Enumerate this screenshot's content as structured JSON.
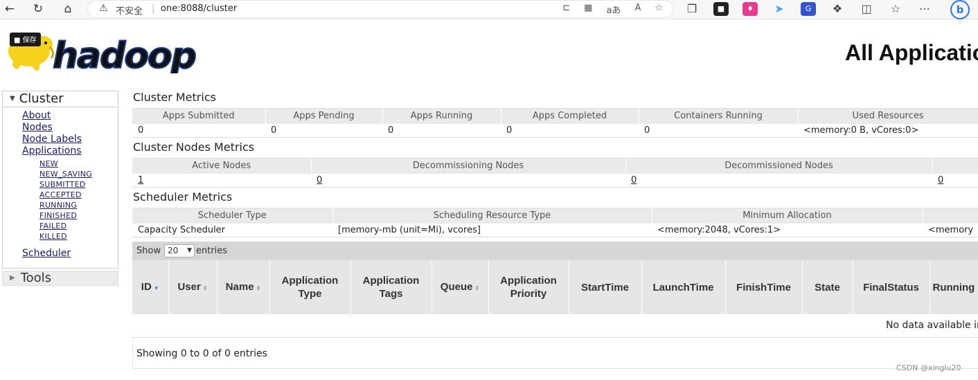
{
  "browser": {
    "warning_text": "不安全",
    "separator": "|",
    "url": "one:8088/cluster",
    "address_icons": [
      "⊏",
      "▦",
      "aあ",
      "A",
      "☆"
    ],
    "ext_colors": [
      "#222222",
      "#e83a8f",
      "#4aa3ff",
      "#3355cc"
    ]
  },
  "header": {
    "save_badge": "保存",
    "logo_text": "hadoop",
    "page_title": "All Applications"
  },
  "sidebar": {
    "cluster_label": "Cluster",
    "links": [
      "About",
      "Nodes",
      "Node Labels",
      "Applications"
    ],
    "app_states": [
      "NEW",
      "NEW_SAVING",
      "SUBMITTED",
      "ACCEPTED",
      "RUNNING",
      "FINISHED",
      "FAILED",
      "KILLED"
    ],
    "scheduler_label": "Scheduler",
    "tools_label": "Tools"
  },
  "cluster_metrics": {
    "title": "Cluster Metrics",
    "headers": [
      "Apps Submitted",
      "Apps Pending",
      "Apps Running",
      "Apps Completed",
      "Containers Running",
      "Used Resources"
    ],
    "values": [
      "0",
      "0",
      "0",
      "0",
      "0",
      "<memory:0 B, vCores:0>"
    ]
  },
  "nodes_metrics": {
    "title": "Cluster Nodes Metrics",
    "headers": [
      "Active Nodes",
      "Decommissioning Nodes",
      "Decommissioned Nodes",
      ""
    ],
    "values": [
      "1",
      "0",
      "0",
      "0"
    ]
  },
  "scheduler_metrics": {
    "title": "Scheduler Metrics",
    "headers": [
      "Scheduler Type",
      "Scheduling Resource Type",
      "Minimum Allocation",
      ""
    ],
    "values": [
      "Capacity Scheduler",
      "[memory-mb (unit=Mi), vcores]",
      "<memory:2048, vCores:1>",
      "<memory"
    ]
  },
  "apps_table": {
    "show_label": "Show",
    "page_size": "20",
    "entries_label": "entries",
    "columns": [
      "ID",
      "User",
      "Name",
      "Application Type",
      "Application Tags",
      "Queue",
      "Application Priority",
      "StartTime",
      "LaunchTime",
      "FinishTime",
      "State",
      "FinalStatus",
      "Running Containers"
    ],
    "no_data": "No data available in table",
    "showing": "Showing 0 to 0 of 0 entries"
  },
  "watermark": "CSDN @xinglu20"
}
